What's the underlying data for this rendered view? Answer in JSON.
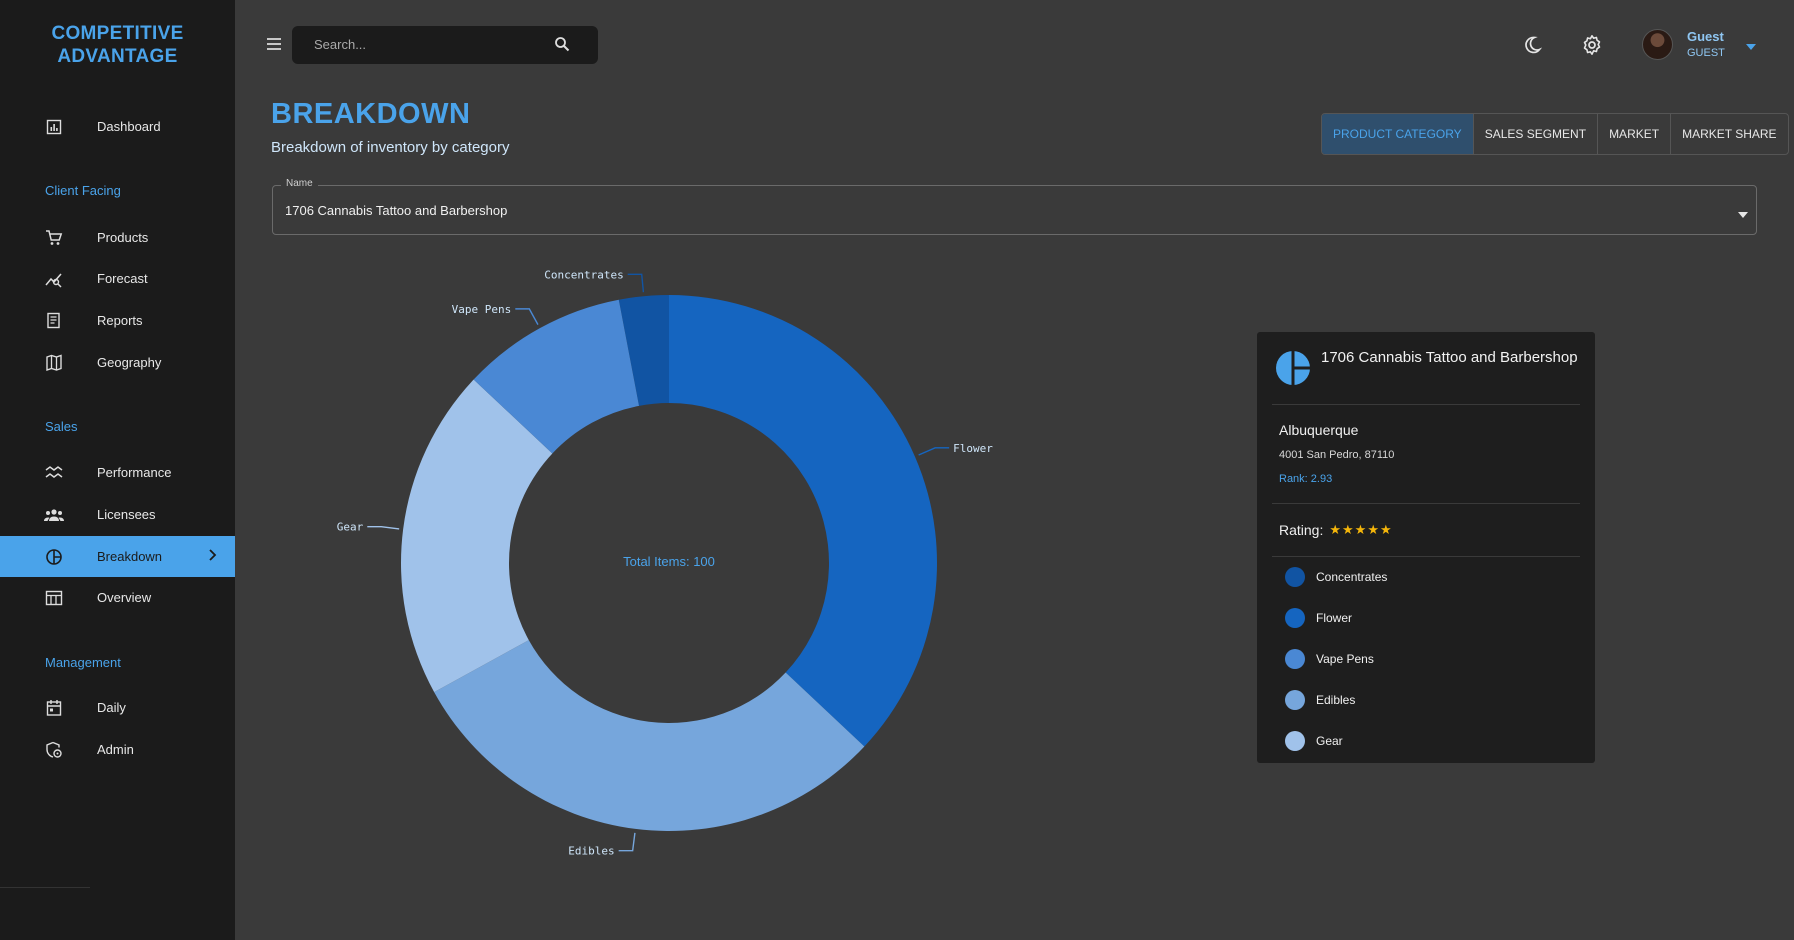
{
  "app": {
    "brand_line1": "COMPETITIVE",
    "brand_line2": "ADVANTAGE"
  },
  "sidebar": {
    "sections": {
      "client_facing": "Client Facing",
      "sales": "Sales",
      "management": "Management"
    },
    "items": [
      {
        "label": "Dashboard",
        "icon": "dashboard-icon"
      },
      {
        "label": "Products",
        "icon": "cart-icon"
      },
      {
        "label": "Forecast",
        "icon": "forecast-icon"
      },
      {
        "label": "Reports",
        "icon": "receipt-icon"
      },
      {
        "label": "Geography",
        "icon": "map-icon"
      },
      {
        "label": "Performance",
        "icon": "trend-icon"
      },
      {
        "label": "Licensees",
        "icon": "group-icon"
      },
      {
        "label": "Breakdown",
        "icon": "pie-icon",
        "active": true
      },
      {
        "label": "Overview",
        "icon": "calendar-view-icon"
      },
      {
        "label": "Daily",
        "icon": "calendar-icon"
      },
      {
        "label": "Admin",
        "icon": "admin-icon"
      }
    ]
  },
  "topbar": {
    "search_placeholder": "Search...",
    "user_name": "Guest",
    "user_role": "GUEST"
  },
  "header": {
    "title": "BREAKDOWN",
    "subtitle": "Breakdown of inventory by category"
  },
  "toggles": [
    {
      "label": "PRODUCT CATEGORY",
      "selected": true
    },
    {
      "label": "SALES SEGMENT",
      "selected": false
    },
    {
      "label": "MARKET",
      "selected": false
    },
    {
      "label": "MARKET SHARE",
      "selected": false
    }
  ],
  "select": {
    "legend": "Name",
    "value": "1706 Cannabis Tattoo and Barbershop"
  },
  "chart_data": {
    "type": "pie",
    "center_label": "Total Items: 100",
    "total": 100,
    "slices": [
      {
        "label": "Concentrates",
        "value": 3,
        "color": "#1154a3"
      },
      {
        "label": "Flower",
        "value": 37,
        "color": "#1565c0"
      },
      {
        "label": "Edibles",
        "value": 30,
        "color": "#76a6dc"
      },
      {
        "label": "Gear",
        "value": 20,
        "color": "#a0c2ea"
      },
      {
        "label": "Vape Pens",
        "value": 10,
        "color": "#4a88d4"
      }
    ]
  },
  "card": {
    "title": "1706 Cannabis Tattoo and Barbershop",
    "city": "Albuquerque",
    "address": "4001 San Pedro, 87110",
    "rank": "Rank: 2.93",
    "rating_label": "Rating:",
    "stars": "★★★★★",
    "legend": [
      {
        "label": "Concentrates",
        "color": "#1154a3"
      },
      {
        "label": "Flower",
        "color": "#1565c0"
      },
      {
        "label": "Vape Pens",
        "color": "#4a88d4"
      },
      {
        "label": "Edibles",
        "color": "#76a6dc"
      },
      {
        "label": "Gear",
        "color": "#a0c2ea"
      }
    ]
  }
}
